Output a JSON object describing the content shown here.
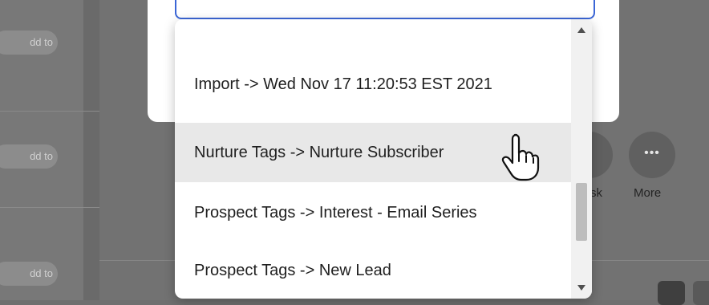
{
  "background": {
    "add_chip_label": "dd to",
    "more_label": "More",
    "partial_label": "sk",
    "more_icon": "ellipsis-icon"
  },
  "dropdown": {
    "options": [
      "Import -> Wed Nov 17 11:20:53 EST 2021",
      "Nurture Tags -> Nurture Subscriber",
      "Prospect Tags -> Interest - Email Series",
      "Prospect Tags -> New Lead"
    ],
    "hovered_index": 1
  },
  "colors": {
    "overlay": "#6f6f6f",
    "hover_row": "#e8e8e8",
    "input_border": "#3b66d6"
  }
}
